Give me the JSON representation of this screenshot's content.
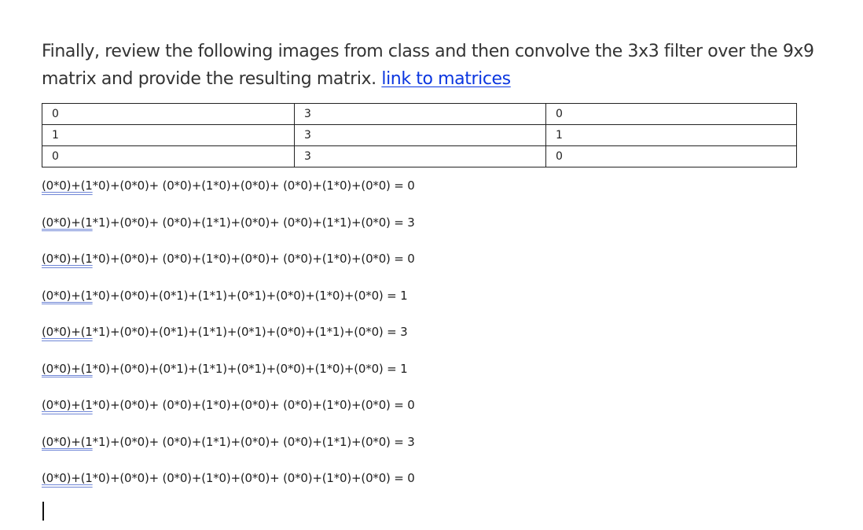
{
  "intro": {
    "text": "Finally, review the following images from class and then convolve the 3x3 filter over the 9x9 matrix and provide the resulting matrix.",
    "link_label": "link to matrices"
  },
  "filter_matrix": [
    [
      "0",
      "3",
      "0"
    ],
    [
      "1",
      "3",
      "1"
    ],
    [
      "0",
      "3",
      "0"
    ]
  ],
  "equations": [
    {
      "lead": "(0*0)+(1",
      "rest": "*0)+(0*0)+ (0*0)+(1*0)+(0*0)+ (0*0)+(1*0)+(0*0) = 0"
    },
    {
      "lead": "(0*0)+(1",
      "rest": "*1)+(0*0)+ (0*0)+(1*1)+(0*0)+ (0*0)+(1*1)+(0*0) = 3"
    },
    {
      "lead": "(0*0)+(1",
      "rest": "*0)+(0*0)+ (0*0)+(1*0)+(0*0)+ (0*0)+(1*0)+(0*0) = 0"
    },
    {
      "lead": "(0*0)+(1",
      "rest": "*0)+(0*0)+(0*1)+(1*1)+(0*1)+(0*0)+(1*0)+(0*0) = 1"
    },
    {
      "lead": "(0*0)+(1",
      "rest": "*1)+(0*0)+(0*1)+(1*1)+(0*1)+(0*0)+(1*1)+(0*0) = 3"
    },
    {
      "lead": "(0*0)+(1",
      "rest": "*0)+(0*0)+(0*1)+(1*1)+(0*1)+(0*0)+(1*0)+(0*0) = 1"
    },
    {
      "lead": "(0*0)+(1",
      "rest": "*0)+(0*0)+ (0*0)+(1*0)+(0*0)+ (0*0)+(1*0)+(0*0) = 0"
    },
    {
      "lead": "(0*0)+(1",
      "rest": "*1)+(0*0)+ (0*0)+(1*1)+(0*0)+ (0*0)+(1*1)+(0*0) = 3"
    },
    {
      "lead": "(0*0)+(1",
      "rest": "*0)+(0*0)+ (0*0)+(1*0)+(0*0)+ (0*0)+(1*0)+(0*0) = 0"
    }
  ],
  "colors": {
    "link": "#0b36e0",
    "spellcheck_underline": "#6f86d6"
  }
}
